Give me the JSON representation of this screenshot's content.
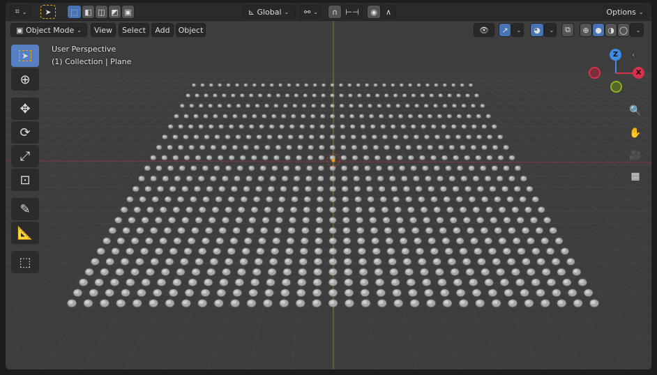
{
  "header": {
    "orientation": "Global",
    "options": "Options"
  },
  "menu": {
    "mode": "Object Mode",
    "items": [
      "View",
      "Select",
      "Add",
      "Object"
    ]
  },
  "overlay": {
    "view_name": "User Perspective",
    "collection": "(1) Collection | Plane"
  },
  "gizmo": {
    "z": "Z",
    "x": "X"
  },
  "colors": {
    "accent": "#4772b3",
    "x_axis": "#d9304d",
    "y_axis": "#8ab31e",
    "z_axis": "#3d8ce6",
    "active_tool": "#5680c2"
  },
  "tools": [
    "select-box-icon",
    "cursor-icon",
    "move-icon",
    "rotate-icon",
    "scale-icon",
    "transform-icon",
    "annotate-icon",
    "measure-icon",
    "add-cube-icon"
  ],
  "nav_icons": [
    "zoom-icon",
    "hand-pan-icon",
    "camera-icon",
    "grid-perspective-icon"
  ]
}
